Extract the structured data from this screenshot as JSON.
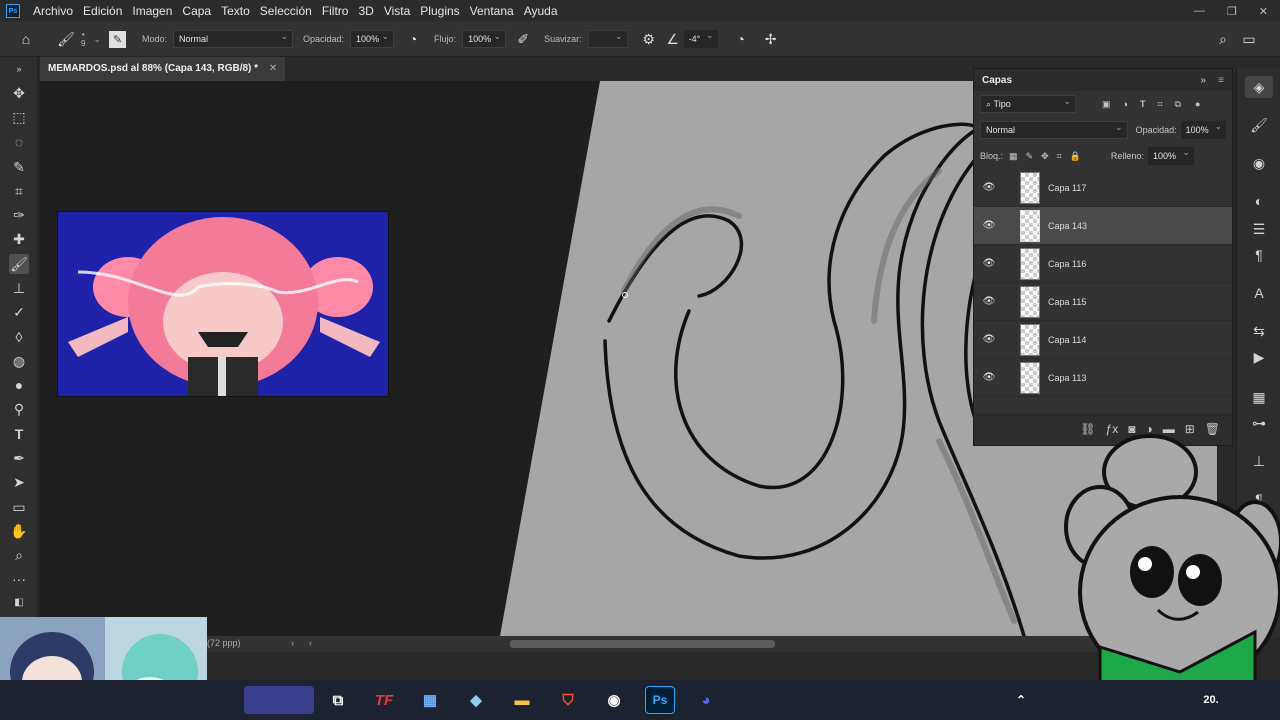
{
  "app": {
    "logo": "Ps"
  },
  "menu": [
    "Archivo",
    "Edición",
    "Imagen",
    "Capa",
    "Texto",
    "Selección",
    "Filtro",
    "3D",
    "Vista",
    "Plugins",
    "Ventana",
    "Ayuda"
  ],
  "options": {
    "brush_size": "9",
    "mode_label": "Modo:",
    "mode_value": "Normal",
    "opacity_label": "Opacidad:",
    "opacity_value": "100%",
    "flow_label": "Flujo:",
    "flow_value": "100%",
    "smooth_label": "Suavizar:",
    "angle_value": "-4°"
  },
  "document": {
    "tab_title": "MEMARDOS.psd al 88% (Capa 143, RGB/8) *",
    "status": "(72 ppp)"
  },
  "layers_panel": {
    "title": "Capas",
    "filter_label": "Tipo",
    "blend_mode": "Normal",
    "opacity_label": "Opacidad:",
    "opacity_value": "100%",
    "lock_label": "Bloq.:",
    "fill_label": "Relleno:",
    "fill_value": "100%",
    "layers": [
      {
        "name": "Capa 117",
        "selected": false
      },
      {
        "name": "Capa 143",
        "selected": true
      },
      {
        "name": "Capa 116",
        "selected": false
      },
      {
        "name": "Capa 115",
        "selected": false
      },
      {
        "name": "Capa 114",
        "selected": false
      },
      {
        "name": "Capa 113",
        "selected": false
      }
    ]
  },
  "colors": {
    "accent": "#31a8ff",
    "canvas_gray": "#a6a6a6",
    "reference_bg": "#1e22a8",
    "bandana": "#1fa84a"
  },
  "icons": {
    "tools": [
      "move-icon",
      "marquee-icon",
      "lasso-icon",
      "quick-select-icon",
      "crop-icon",
      "eyedropper-icon",
      "healing-icon",
      "brush-icon",
      "stamp-icon",
      "history-brush-icon",
      "eraser-icon",
      "bucket-icon",
      "blur-icon",
      "dodge-icon",
      "type-icon",
      "pen-icon",
      "path-select-icon",
      "rectangle-icon",
      "hand-icon",
      "zoom-icon",
      "more-icon"
    ]
  },
  "taskbar": {
    "tf_label": "TF",
    "ps_label": "Ps",
    "clock": "20."
  }
}
